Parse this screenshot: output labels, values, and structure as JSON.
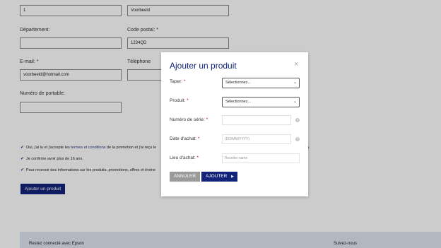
{
  "form": {
    "field_1_value": "1",
    "field_2_value": "Voorbeeld",
    "departement_label": "Département:",
    "departement_value": "",
    "postal_code_label": "Code postal:",
    "postal_code_value": "1234QD",
    "email_label": "E-mail:",
    "email_value": "voorbeeld@hotmail.com",
    "telephone_label": "Téléphone",
    "mobile_label": "Numéro de portable:",
    "mobile_value": "",
    "required_mark": "*"
  },
  "consents": {
    "terms_prefix": "Oui, j'ai lu et j'accepte les ",
    "terms_link": "termes et conditions",
    "terms_suffix": " de la promotion et j'ai reçu le",
    "age": "Je confirme avoir plus de 16 ans.",
    "info": "Pour recevoir des informations sur les produits, promotions, offres et évène",
    "overflow_tail": "on."
  },
  "add_product_button": "Ajouter un produit",
  "footer": {
    "left": "Restez connecté avec Epson",
    "right": "Suivez-nous"
  },
  "modal": {
    "title": "Ajouter un produit",
    "close": "×",
    "type_label": "Taper:",
    "type_value": "Sélectionnez...",
    "product_label": "Produit:",
    "product_value": "Sélectionnez...",
    "serial_label": "Numéro de série:",
    "serial_value": "",
    "date_label": "Date d'achat:",
    "date_placeholder": "(DD/MM/YYYY)",
    "place_label": "Lieu d'achat:",
    "place_placeholder": "Reseller name",
    "required_mark": "*",
    "cancel_button": "ANNULER",
    "add_button": "AJOUTER",
    "info_glyph": "?"
  },
  "colors": {
    "primary": "#13237a",
    "link": "#2b3a8c",
    "cancel": "#9a9a9a",
    "footer_bg": "#dfe6f0",
    "required": "#cc0000"
  }
}
